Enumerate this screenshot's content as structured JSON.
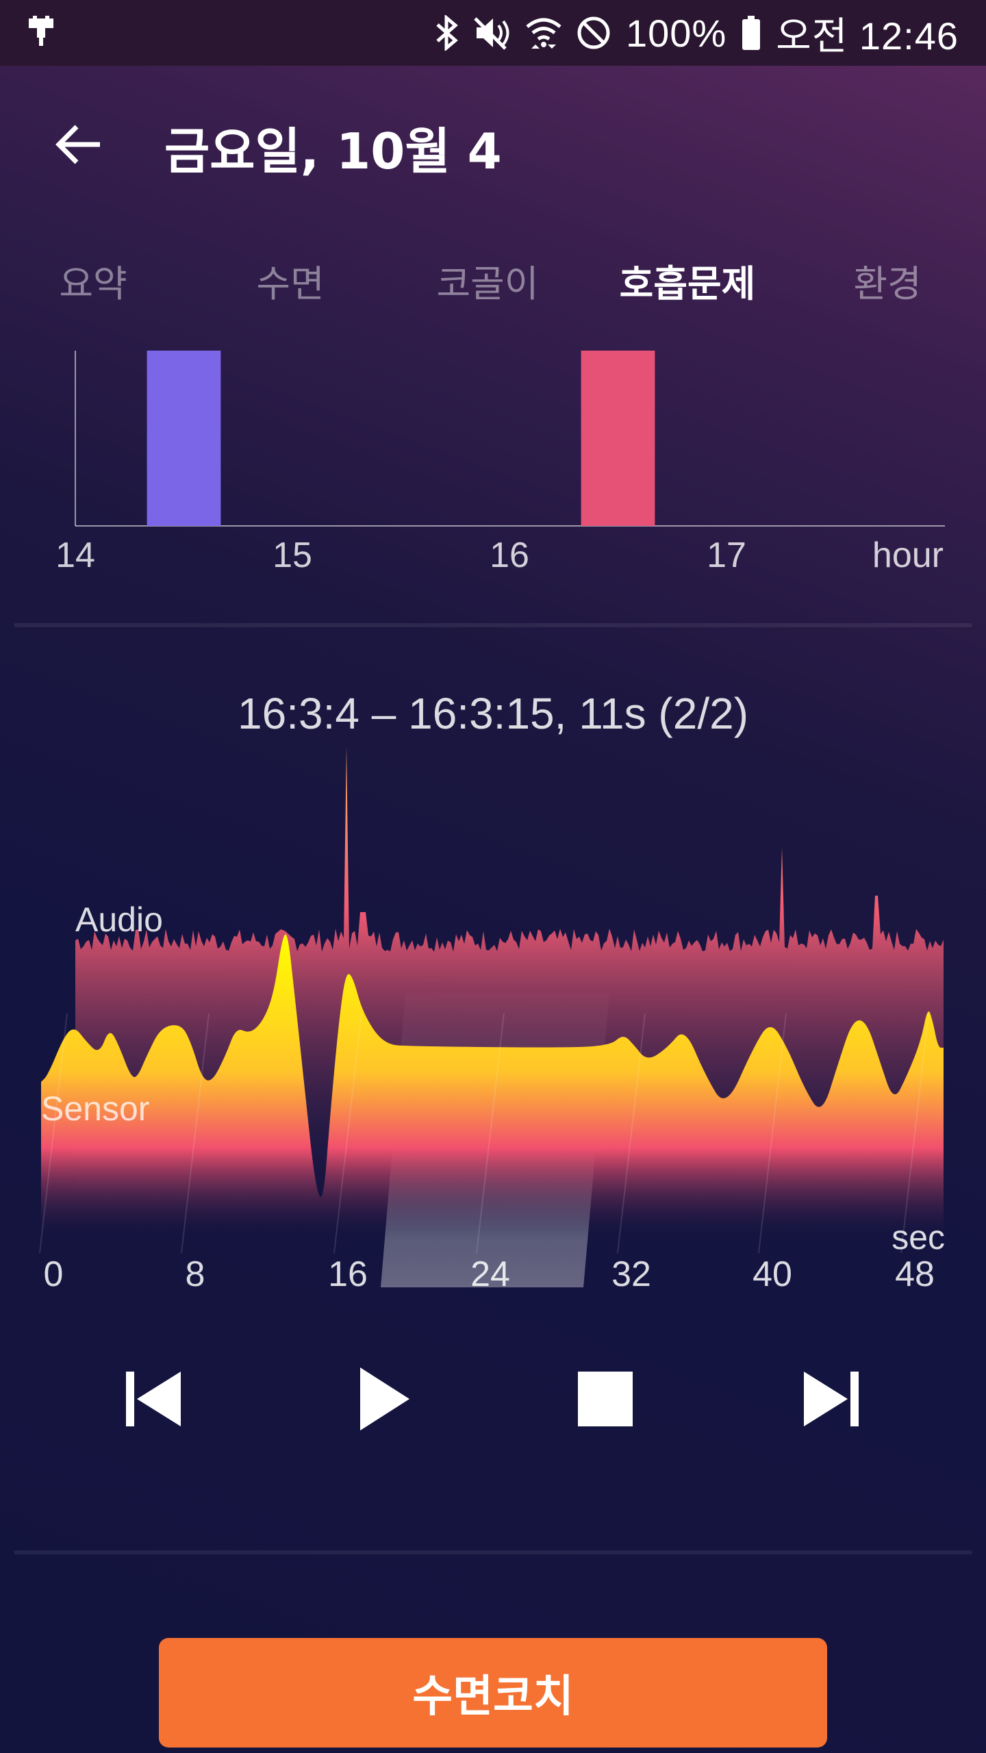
{
  "status_bar": {
    "battery": "100%",
    "time": "오전 12:46",
    "icons": [
      "usb-icon",
      "bluetooth-icon",
      "mute-icon",
      "wifi-icon",
      "dnd-icon",
      "battery-icon"
    ]
  },
  "header": {
    "title": "금요일, 10월 4"
  },
  "tabs": [
    {
      "label": "요약",
      "active": false
    },
    {
      "label": "수면",
      "active": false
    },
    {
      "label": "코골이",
      "active": false
    },
    {
      "label": "호흡문제",
      "active": true
    },
    {
      "label": "환경",
      "active": false
    }
  ],
  "colors": {
    "bar_purple": "#7b66e8",
    "bar_pink": "#e65276",
    "button_orange": "#f57232",
    "wave_yellow": "#ffff00",
    "wave_red": "#f2506e"
  },
  "chart_data": [
    {
      "type": "bar",
      "x_ticks": [
        "14",
        "15",
        "16",
        "17"
      ],
      "x_unit": "hour",
      "xlim": [
        14,
        18
      ],
      "bars": [
        {
          "start": 14.33,
          "end": 14.67,
          "color": "#7b66e8"
        },
        {
          "start": 16.33,
          "end": 16.67,
          "color": "#e65276"
        }
      ]
    },
    {
      "type": "area",
      "segment_label": "16:3:4 – 16:3:15, 11s (2/2)",
      "x_ticks": [
        "0",
        "8",
        "16",
        "24",
        "32",
        "40",
        "48"
      ],
      "x_unit": "sec",
      "series": [
        {
          "name": "Audio"
        },
        {
          "name": "Sensor"
        }
      ],
      "highlight_range_sec": [
        20,
        31
      ]
    }
  ],
  "controls": {
    "prev": "skip-previous-icon",
    "play": "play-icon",
    "stop": "stop-icon",
    "next": "skip-next-icon"
  },
  "coach_button": {
    "label": "수면코치"
  }
}
